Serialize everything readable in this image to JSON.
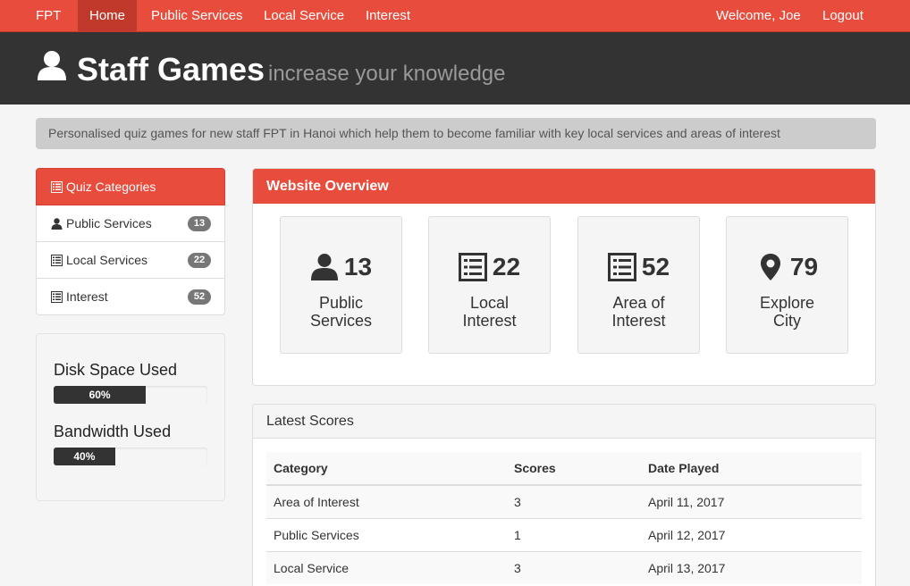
{
  "nav": {
    "brand": "FPT",
    "home": "Home",
    "public_services": "Public Services",
    "local_service": "Local Service",
    "interest": "Interest",
    "welcome": "Welcome, Joe",
    "logout": "Logout"
  },
  "header": {
    "title": "Staff Games",
    "subtitle": "increase your knowledge"
  },
  "intro": "Personalised quiz games for new staff FPT in Hanoi which help them to become familiar with key local services and areas of interest",
  "sidebar": {
    "heading": "Quiz Categories",
    "items": [
      {
        "label": "Public Services",
        "count": "13",
        "icon": "user-icon"
      },
      {
        "label": "Local Services",
        "count": "22",
        "icon": "list-icon"
      },
      {
        "label": "Interest",
        "count": "52",
        "icon": "list-icon"
      }
    ]
  },
  "stats": {
    "disk_label": "Disk Space Used",
    "disk_value": 0.6,
    "disk_text": "60%",
    "bandwidth_label": "Bandwidth Used",
    "bandwidth_value": 0.4,
    "bandwidth_text": "40%"
  },
  "overview": {
    "heading": "Website Overview",
    "tiles": [
      {
        "count": "13",
        "line1": "Public",
        "line2": "Services",
        "icon": "user-icon"
      },
      {
        "count": "22",
        "line1": "Local",
        "line2": "Interest",
        "icon": "list-icon"
      },
      {
        "count": "52",
        "line1": "Area of",
        "line2": "Interest",
        "icon": "list-icon"
      },
      {
        "count": "79",
        "line1": "Explore",
        "line2": "City",
        "icon": "map-marker-icon"
      }
    ]
  },
  "scores": {
    "heading": "Latest Scores",
    "columns": [
      "Category",
      "Scores",
      "Date Played"
    ],
    "rows": [
      [
        "Area of Interest",
        "3",
        "April 11, 2017"
      ],
      [
        "Public Services",
        "1",
        "April 12, 2017"
      ],
      [
        "Local Service",
        "3",
        "April 13, 2017"
      ]
    ]
  },
  "colors": {
    "accent": "#e74c3c",
    "header_bg": "#333333"
  }
}
